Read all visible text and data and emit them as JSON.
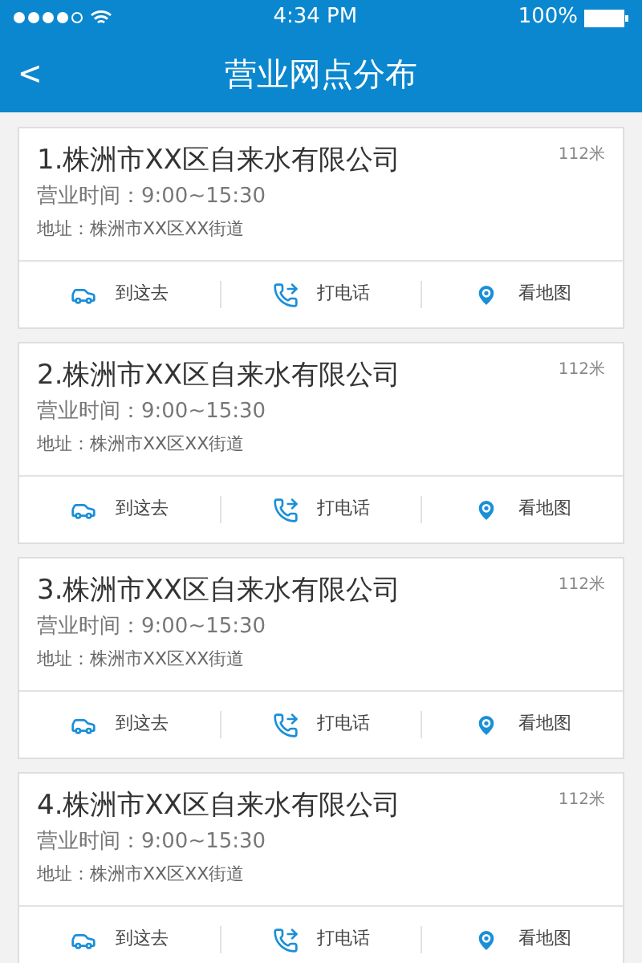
{
  "status_bar": {
    "time": "4:34 PM",
    "battery": "100%"
  },
  "header": {
    "back": "<",
    "title": "营业网点分布"
  },
  "branches": [
    {
      "name": "1.株洲市XX区自来水有限公司",
      "distance": "112米",
      "hours": "营业时间：9:00~15:30",
      "address": "地址：株洲市XX区XX街道",
      "actions": [
        {
          "kind": "car",
          "label": "到这去"
        },
        {
          "kind": "phone",
          "label": "打电话"
        },
        {
          "kind": "pin",
          "label": "看地图"
        }
      ]
    },
    {
      "name": "2.株洲市XX区自来水有限公司",
      "distance": "112米",
      "hours": "营业时间：9:00~15:30",
      "address": "地址：株洲市XX区XX街道",
      "actions": [
        {
          "kind": "car",
          "label": "到这去"
        },
        {
          "kind": "phone",
          "label": "打电话"
        },
        {
          "kind": "pin",
          "label": "看地图"
        }
      ]
    },
    {
      "name": "3.株洲市XX区自来水有限公司",
      "distance": "112米",
      "hours": "营业时间：9:00~15:30",
      "address": "地址：株洲市XX区XX街道",
      "actions": [
        {
          "kind": "car",
          "label": "到这去"
        },
        {
          "kind": "phone",
          "label": "打电话"
        },
        {
          "kind": "pin",
          "label": "看地图"
        }
      ]
    },
    {
      "name": "4.株洲市XX区自来水有限公司",
      "distance": "112米",
      "hours": "营业时间：9:00~15:30",
      "address": "地址：株洲市XX区XX街道",
      "actions": [
        {
          "kind": "car",
          "label": "到这去"
        },
        {
          "kind": "phone",
          "label": "打电话"
        },
        {
          "kind": "pin",
          "label": "看地图"
        }
      ]
    }
  ]
}
